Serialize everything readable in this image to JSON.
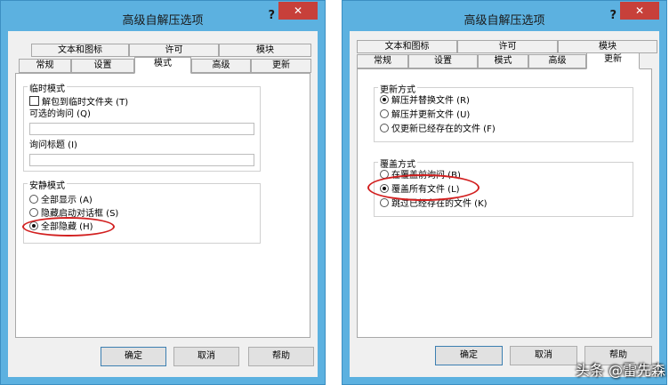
{
  "dialog1": {
    "title": "高级自解压选项",
    "help": "?",
    "close": "✕",
    "tabs_back": [
      "文本和图标",
      "许可",
      "模块"
    ],
    "tabs_front": [
      "常规",
      "设置",
      "模式",
      "高级",
      "更新"
    ],
    "active_tab": "模式",
    "temp_group": {
      "label": "临时模式",
      "checkbox": "解包到临时文件夹 (T)",
      "optional_question": "可选的询问 (Q)",
      "question_title": "询问标题 (I)"
    },
    "silent_group": {
      "label": "安静模式",
      "options": [
        "全部显示 (A)",
        "隐藏启动对话框 (S)",
        "全部隐藏 (H)"
      ],
      "selected": 2
    },
    "buttons": [
      "确定",
      "取消",
      "帮助"
    ]
  },
  "dialog2": {
    "title": "高级自解压选项",
    "help": "?",
    "close": "✕",
    "tabs_back": [
      "文本和图标",
      "许可",
      "模块"
    ],
    "tabs_front": [
      "常规",
      "设置",
      "模式",
      "高级",
      "更新"
    ],
    "active_tab": "更新",
    "update_group": {
      "label": "更新方式",
      "options": [
        "解压并替换文件 (R)",
        "解压并更新文件 (U)",
        "仅更新已经存在的文件 (F)"
      ],
      "selected": 0
    },
    "overwrite_group": {
      "label": "覆盖方式",
      "options": [
        "在覆盖前询问 (B)",
        "覆盖所有文件 (L)",
        "跳过已经存在的文件 (K)"
      ],
      "selected": 1
    },
    "buttons": [
      "确定",
      "取消",
      "帮助"
    ]
  },
  "watermark": "头条 @雷先森",
  "colors": {
    "titlebar": "#5cb1e0",
    "close": "#c7403a",
    "highlight": "#d21f1f"
  }
}
